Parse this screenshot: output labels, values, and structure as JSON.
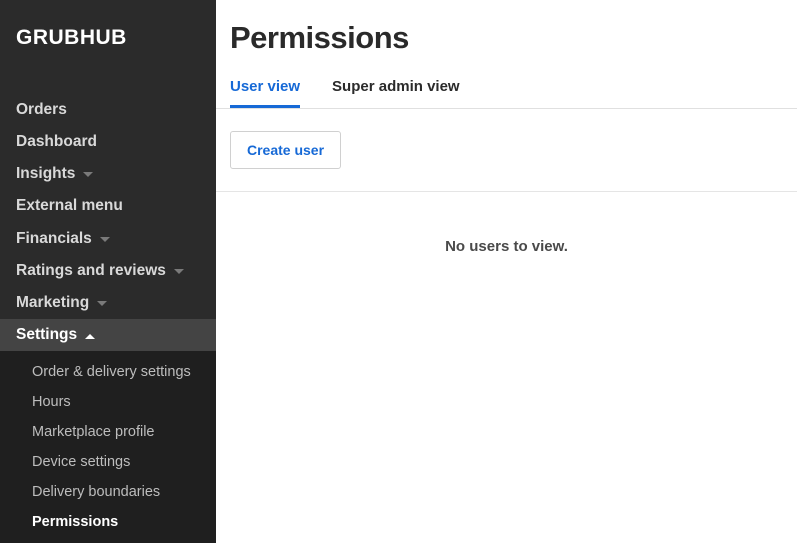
{
  "brand": "GRUBHUB",
  "sidebar": {
    "items": [
      {
        "label": "Orders",
        "hasCaret": false
      },
      {
        "label": "Dashboard",
        "hasCaret": false
      },
      {
        "label": "Insights",
        "hasCaret": true
      },
      {
        "label": "External menu",
        "hasCaret": false
      },
      {
        "label": "Financials",
        "hasCaret": true
      },
      {
        "label": "Ratings and reviews",
        "hasCaret": true
      },
      {
        "label": "Marketing",
        "hasCaret": true
      },
      {
        "label": "Settings",
        "hasCaret": true,
        "expanded": true
      }
    ],
    "settingsSub": [
      "Order & delivery settings",
      "Hours",
      "Marketplace profile",
      "Device settings",
      "Delivery boundaries",
      "Permissions"
    ]
  },
  "page": {
    "title": "Permissions",
    "tabs": {
      "userView": "User view",
      "superAdminView": "Super admin view"
    },
    "createUser": "Create user",
    "emptyState": "No users to view."
  }
}
